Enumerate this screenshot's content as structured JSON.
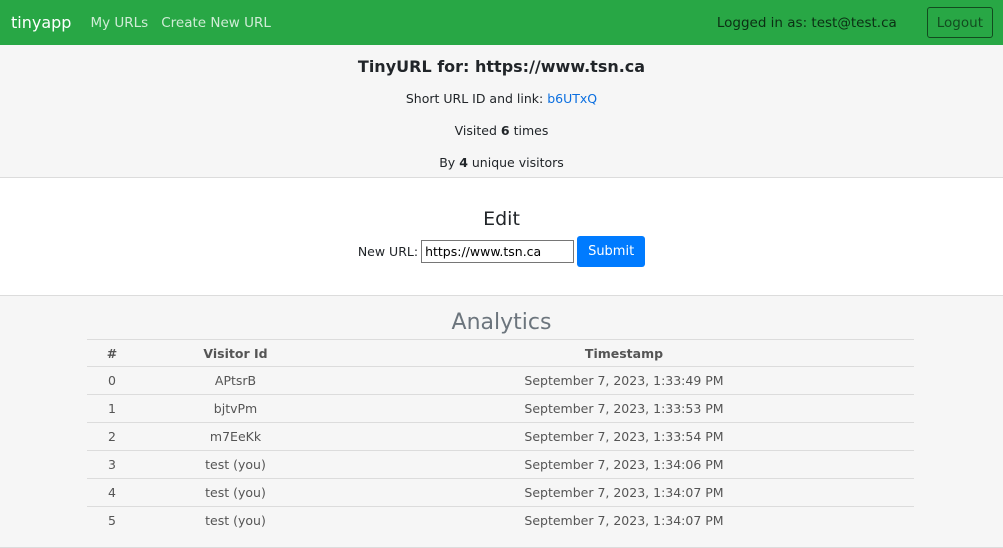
{
  "nav": {
    "brand": "tinyapp",
    "links": [
      "My URLs",
      "Create New URL"
    ],
    "login_status": "Logged in as: test@test.ca",
    "logout_label": "Logout"
  },
  "summary": {
    "title": "TinyURL for: https://www.tsn.ca",
    "short_url_label": "Short URL ID and link:",
    "short_id": "b6UTxQ",
    "visited_prefix": "Visited",
    "visited_count": "6",
    "visited_suffix": "times",
    "unique_prefix": "By",
    "unique_count": "4",
    "unique_suffix": "unique visitors"
  },
  "edit": {
    "title": "Edit",
    "label": "New URL:",
    "value": "https://www.tsn.ca",
    "submit_label": "Submit"
  },
  "analytics": {
    "title": "Analytics",
    "headers": [
      "#",
      "Visitor Id",
      "Timestamp"
    ],
    "rows": [
      [
        "0",
        "APtsrB",
        "September 7, 2023, 1:33:49 PM"
      ],
      [
        "1",
        "bjtvPm",
        "September 7, 2023, 1:33:53 PM"
      ],
      [
        "2",
        "m7EeKk",
        "September 7, 2023, 1:33:54 PM"
      ],
      [
        "3",
        "test (you)",
        "September 7, 2023, 1:34:06 PM"
      ],
      [
        "4",
        "test (you)",
        "September 7, 2023, 1:34:07 PM"
      ],
      [
        "5",
        "test (you)",
        "September 7, 2023, 1:34:07 PM"
      ]
    ]
  },
  "colors": {
    "navbar": "#28a745",
    "primary": "#007bff",
    "link": "#0b6fe0"
  }
}
